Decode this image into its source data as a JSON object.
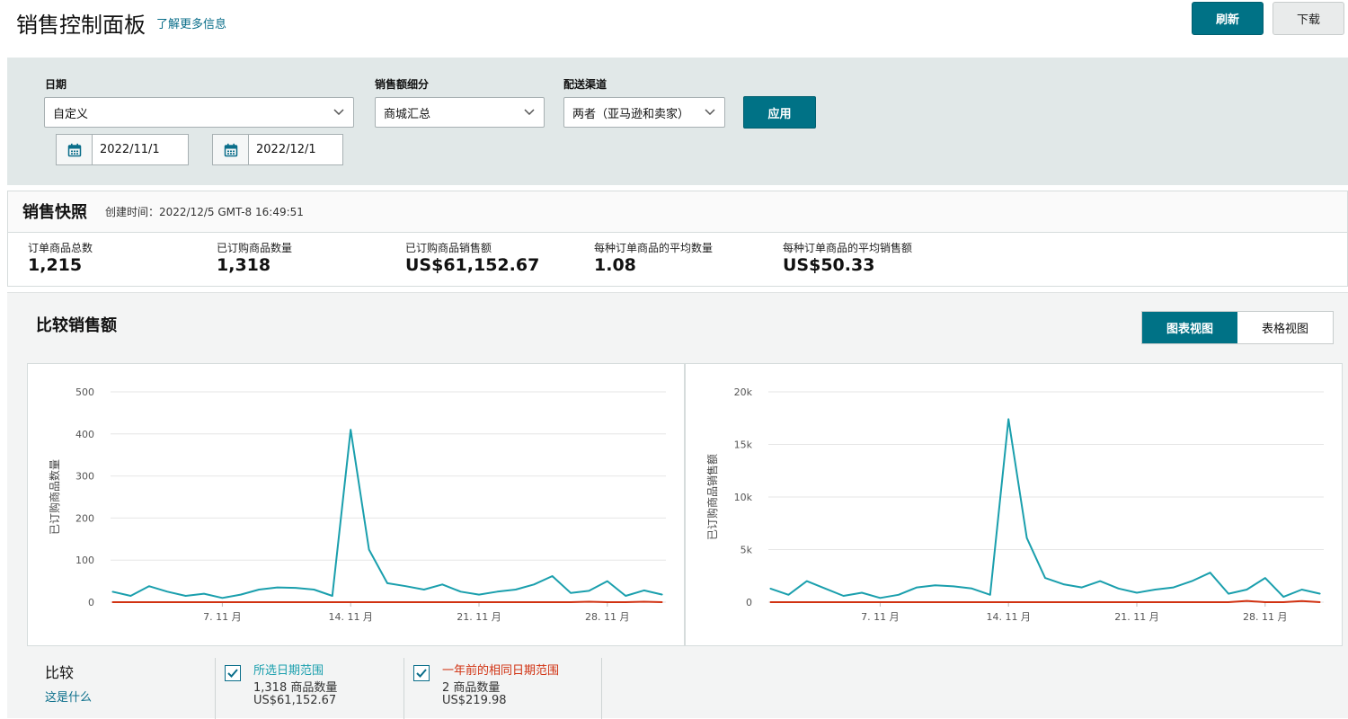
{
  "header": {
    "title": "销售控制面板",
    "learn_more": "了解更多信息",
    "refresh_label": "刷新",
    "download_label": "下载"
  },
  "filters": {
    "date_label": "日期",
    "date_value": "自定义",
    "start_date": "2022/11/1",
    "end_date": "2022/12/1",
    "breakdown_label": "销售额细分",
    "breakdown_value": "商城汇总",
    "channel_label": "配送渠道",
    "channel_value": "两者（亚马逊和卖家）",
    "apply_label": "应用"
  },
  "snapshot": {
    "title": "销售快照",
    "created": "创建时间：2022/12/5 GMT-8 16:49:51",
    "metrics": [
      {
        "label": "订单商品总数",
        "value": "1,215"
      },
      {
        "label": "已订购商品数量",
        "value": "1,318"
      },
      {
        "label": "已订购商品销售额",
        "value": "US$61,152.67"
      },
      {
        "label": "每种订单商品的平均数量",
        "value": "1.08"
      },
      {
        "label": "每种订单商品的平均销售额",
        "value": "US$50.33"
      }
    ]
  },
  "compare": {
    "title": "比较销售额",
    "chart_view": "图表视图",
    "table_view": "表格视图",
    "compare_label": "比较",
    "what_is": "这是什么",
    "legend": [
      {
        "title": "所选日期范围",
        "line2": "1,318 商品数量",
        "line3": "US$61,152.67",
        "color": "#1a9fad"
      },
      {
        "title": "一年前的相同日期范围",
        "line2": "2 商品数量",
        "line3": "US$219.98",
        "color": "#d13212"
      }
    ]
  },
  "colors": {
    "accent": "#007286",
    "current_series": "#1a9fad",
    "previous_series": "#d13212",
    "link": "#0a6e8a"
  },
  "chart_data": [
    {
      "type": "line",
      "ylabel": "已订购商品数量",
      "xlabel": "",
      "ylim": [
        0,
        500
      ],
      "yticks": [
        "0",
        "100",
        "200",
        "300",
        "400",
        "500"
      ],
      "ytick_values": [
        0,
        100,
        200,
        300,
        400,
        500
      ],
      "x": [
        "2022-11-01",
        "2022-11-02",
        "2022-11-03",
        "2022-11-04",
        "2022-11-05",
        "2022-11-06",
        "2022-11-07",
        "2022-11-08",
        "2022-11-09",
        "2022-11-10",
        "2022-11-11",
        "2022-11-12",
        "2022-11-13",
        "2022-11-14",
        "2022-11-15",
        "2022-11-16",
        "2022-11-17",
        "2022-11-18",
        "2022-11-19",
        "2022-11-20",
        "2022-11-21",
        "2022-11-22",
        "2022-11-23",
        "2022-11-24",
        "2022-11-25",
        "2022-11-26",
        "2022-11-27",
        "2022-11-28",
        "2022-11-29",
        "2022-11-30",
        "2022-12-01"
      ],
      "xticks": [
        {
          "index": 6,
          "label": "7. 11 月"
        },
        {
          "index": 13,
          "label": "14. 11 月"
        },
        {
          "index": 20,
          "label": "21. 11 月"
        },
        {
          "index": 27,
          "label": "28. 11 月"
        }
      ],
      "series": [
        {
          "values": [
            25,
            15,
            38,
            25,
            15,
            20,
            10,
            18,
            30,
            35,
            34,
            30,
            15,
            410,
            125,
            45,
            38,
            30,
            42,
            25,
            18,
            25,
            30,
            42,
            62,
            22,
            27,
            50,
            15,
            28,
            18
          ]
        },
        {
          "values": [
            0,
            0,
            0,
            0,
            0,
            0,
            0,
            0,
            0,
            0,
            0,
            0,
            0,
            0,
            0,
            0,
            0,
            0,
            0,
            0,
            0,
            0,
            0,
            0,
            0,
            0,
            1,
            0,
            0,
            1,
            0
          ]
        }
      ]
    },
    {
      "type": "line",
      "ylabel": "已订购商品销售额",
      "xlabel": "",
      "ylim": [
        0,
        20000
      ],
      "yticks": [
        "0",
        "5k",
        "10k",
        "15k",
        "20k"
      ],
      "ytick_values": [
        0,
        5000,
        10000,
        15000,
        20000
      ],
      "x": [
        "2022-11-01",
        "2022-11-02",
        "2022-11-03",
        "2022-11-04",
        "2022-11-05",
        "2022-11-06",
        "2022-11-07",
        "2022-11-08",
        "2022-11-09",
        "2022-11-10",
        "2022-11-11",
        "2022-11-12",
        "2022-11-13",
        "2022-11-14",
        "2022-11-15",
        "2022-11-16",
        "2022-11-17",
        "2022-11-18",
        "2022-11-19",
        "2022-11-20",
        "2022-11-21",
        "2022-11-22",
        "2022-11-23",
        "2022-11-24",
        "2022-11-25",
        "2022-11-26",
        "2022-11-27",
        "2022-11-28",
        "2022-11-29",
        "2022-11-30",
        "2022-12-01"
      ],
      "xticks": [
        {
          "index": 6,
          "label": "7. 11 月"
        },
        {
          "index": 13,
          "label": "14. 11 月"
        },
        {
          "index": 20,
          "label": "21. 11 月"
        },
        {
          "index": 27,
          "label": "28. 11 月"
        }
      ],
      "series": [
        {
          "values": [
            1300,
            700,
            2000,
            1300,
            600,
            900,
            400,
            700,
            1400,
            1600,
            1500,
            1300,
            700,
            17400,
            6100,
            2300,
            1700,
            1400,
            2000,
            1300,
            900,
            1200,
            1400,
            2000,
            2800,
            800,
            1200,
            2300,
            500,
            1200,
            800
          ]
        },
        {
          "values": [
            0,
            0,
            0,
            0,
            0,
            0,
            0,
            0,
            0,
            0,
            0,
            0,
            0,
            0,
            0,
            0,
            0,
            0,
            0,
            0,
            0,
            0,
            0,
            0,
            0,
            0,
            120,
            0,
            0,
            110,
            0
          ]
        }
      ]
    }
  ]
}
